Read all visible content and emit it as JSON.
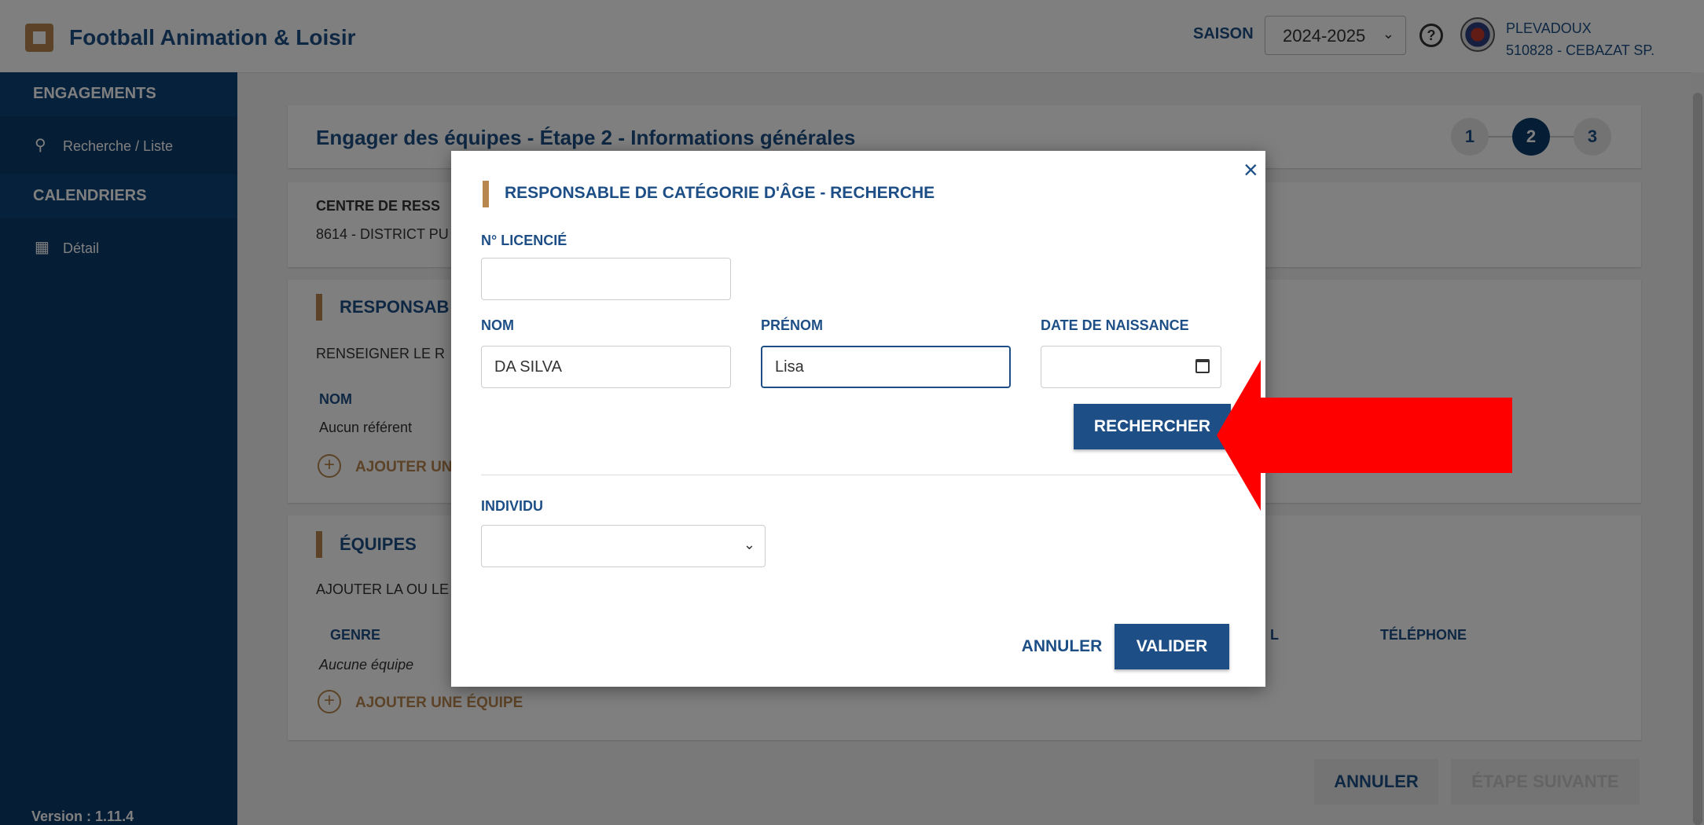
{
  "header": {
    "app_title": "Football Animation & Loisir",
    "season_label": "SAISON",
    "season_value": "2024-2025",
    "user_name": "PLEVADOUX",
    "user_club": "510828 - CEBAZAT SP."
  },
  "sidebar": {
    "sections": [
      {
        "title": "ENGAGEMENTS",
        "items": [
          {
            "label": "Recherche / Liste",
            "icon": "search-icon"
          }
        ]
      },
      {
        "title": "CALENDRIERS",
        "items": [
          {
            "label": "Détail",
            "icon": "calendar-icon"
          }
        ]
      }
    ],
    "version": "Version : 1.11.4"
  },
  "main": {
    "page_title": "Engager des équipes - Étape 2 - Informations générales",
    "steps": [
      "1",
      "2",
      "3"
    ],
    "active_step": 2,
    "centre": {
      "title": "CENTRE DE RESS",
      "value": "8614 - DISTRICT PU"
    },
    "responsable": {
      "title": "RESPONSAB",
      "hint": "RENSEIGNER LE R",
      "col_nom": "NOM",
      "empty": "Aucun référent",
      "add_label": "AJOUTER UN"
    },
    "equipes": {
      "title": "ÉQUIPES",
      "hint": "AJOUTER LA OU LE",
      "col_genre": "GENRE",
      "col_l": "L",
      "col_tel": "TÉLÉPHONE",
      "empty": "Aucune équipe",
      "add_label": "AJOUTER UNE ÉQUIPE"
    },
    "cancel_label": "ANNULER",
    "next_label": "ÉTAPE SUIVANTE"
  },
  "modal": {
    "close": "×",
    "title": "RESPONSABLE DE CATÉGORIE D'ÂGE - RECHERCHE",
    "licence_label": "N° LICENCIÉ",
    "licence_value": "",
    "nom_label": "NOM",
    "nom_value": "DA SILVA",
    "prenom_label": "PRÉNOM",
    "prenom_value": "Lisa",
    "naissance_label": "DATE DE NAISSANCE",
    "search_label": "RECHERCHER",
    "individu_label": "INDIVIDU",
    "cancel_label": "ANNULER",
    "validate_label": "VALIDER"
  },
  "colors": {
    "primary": "#1d4f86",
    "sidebar": "#0a3a6b",
    "accent": "#b8874f",
    "arrow": "#ff0000"
  }
}
